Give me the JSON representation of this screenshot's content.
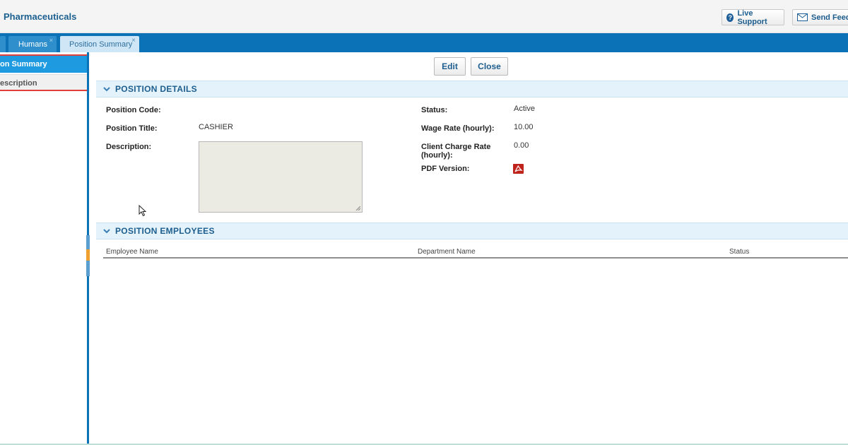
{
  "header": {
    "app_title": "Pharmaceuticals",
    "live_support": "Live Support",
    "send_feedback": "Send Feedb"
  },
  "tabs": [
    {
      "label": "Humans",
      "close": "×"
    },
    {
      "label": "Position Summary",
      "close": "×"
    }
  ],
  "sidenav": {
    "items": [
      {
        "label": "on Summary",
        "active": true
      },
      {
        "label": "escription",
        "active": false
      }
    ]
  },
  "toolbar": {
    "edit_label": "Edit",
    "close_label": "Close"
  },
  "position_details": {
    "section_title": "POSITION DETAILS",
    "position_code_label": "Position Code:",
    "position_code_value": "",
    "position_title_label": "Position Title:",
    "position_title_value": "CASHIER",
    "description_label": "Description:",
    "description_value": "",
    "status_label": "Status:",
    "status_value": "Active",
    "wage_rate_label": "Wage Rate (hourly):",
    "wage_rate_value": "10.00",
    "client_charge_label_line1": "Client Charge Rate",
    "client_charge_label_line2": "(hourly):",
    "client_charge_value": "0.00",
    "pdf_label": "PDF Version:"
  },
  "position_employees": {
    "section_title": "POSITION EMPLOYEES",
    "columns": [
      "Employee Name",
      "Department Name",
      "Status"
    ],
    "rows": []
  },
  "icons": {
    "live_support": "question-circle-icon",
    "send_feedback": "envelope-icon",
    "section_toggle": "chevron-down-icon",
    "pdf": "pdf-icon"
  },
  "colors": {
    "tab_bar": "#0b72b7",
    "nav_active": "#1e9ae0",
    "section_header_bg": "#e3f2fb",
    "title_text": "#1d5e8e",
    "pdf_red": "#c0231c",
    "highlight_border": "#e0403a"
  }
}
